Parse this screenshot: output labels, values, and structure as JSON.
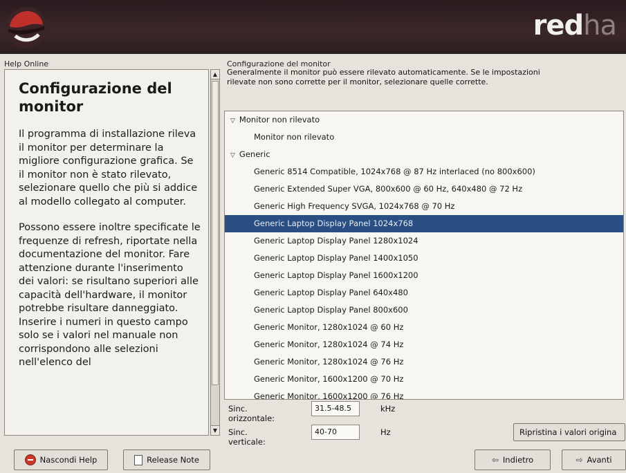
{
  "banner": {
    "brand_red": "red",
    "brand_hat": "ha"
  },
  "help": {
    "frame_label": "Help Online",
    "title": "Configurazione del monitor",
    "paragraphs": [
      "Il programma di installazione rileva il monitor per determinare la migliore configurazione grafica. Se il monitor non è stato rilevato, selezionare quello che più si addice al modello collegato al computer.",
      "Possono essere inoltre specificate le frequenze di refresh, riportate nella documentazione del monitor. Fare attenzione durante l'inserimento dei valori: se risultano superiori alle capacità dell'hardware, il monitor potrebbe risultare danneggiato. Inserire i numeri in questo campo solo se i valori nel manuale non corrispondono alle selezioni nell'elenco del"
    ]
  },
  "monitor": {
    "section_label": "Configurazione del monitor",
    "description": "Generalmente il monitor può essere rilevato automaticamente. Se le impostazioni rilevate non sono corrette per il monitor, selezionare quelle corrette.",
    "list": [
      {
        "label": "Monitor non rilevato",
        "type": "group"
      },
      {
        "label": "Monitor non rilevato",
        "type": "child"
      },
      {
        "label": "Generic",
        "type": "group"
      },
      {
        "label": "Generic 8514 Compatible, 1024x768 @ 87 Hz interlaced (no 800x600)",
        "type": "child"
      },
      {
        "label": "Generic Extended Super VGA, 800x600 @ 60 Hz, 640x480 @ 72 Hz",
        "type": "child"
      },
      {
        "label": "Generic High Frequency SVGA, 1024x768 @ 70 Hz",
        "type": "child"
      },
      {
        "label": "Generic Laptop Display Panel 1024x768",
        "type": "child",
        "selected": true
      },
      {
        "label": "Generic Laptop Display Panel 1280x1024",
        "type": "child"
      },
      {
        "label": "Generic Laptop Display Panel 1400x1050",
        "type": "child"
      },
      {
        "label": "Generic Laptop Display Panel 1600x1200",
        "type": "child"
      },
      {
        "label": "Generic Laptop Display Panel 640x480",
        "type": "child"
      },
      {
        "label": "Generic Laptop Display Panel 800x600",
        "type": "child"
      },
      {
        "label": "Generic Monitor, 1280x1024 @ 60 Hz",
        "type": "child"
      },
      {
        "label": "Generic Monitor, 1280x1024 @ 74 Hz",
        "type": "child"
      },
      {
        "label": "Generic Monitor, 1280x1024 @ 76 Hz",
        "type": "child"
      },
      {
        "label": "Generic Monitor, 1600x1200 @ 70 Hz",
        "type": "child"
      },
      {
        "label": "Generic Monitor, 1600x1200 @ 76 Hz",
        "type": "child"
      }
    ],
    "hsync_label": "Sinc. orizzontale:",
    "hsync_value": "31.5-48.5",
    "hsync_unit": "kHz",
    "vsync_label": "Sinc. verticale:",
    "vsync_value": "40-70",
    "vsync_unit": "Hz",
    "restore_button": "Ripristina i valori origina"
  },
  "footer": {
    "hide_help": "Nascondi Help",
    "release_notes": "Release Note",
    "back": "Indietro",
    "next": "Avanti"
  }
}
